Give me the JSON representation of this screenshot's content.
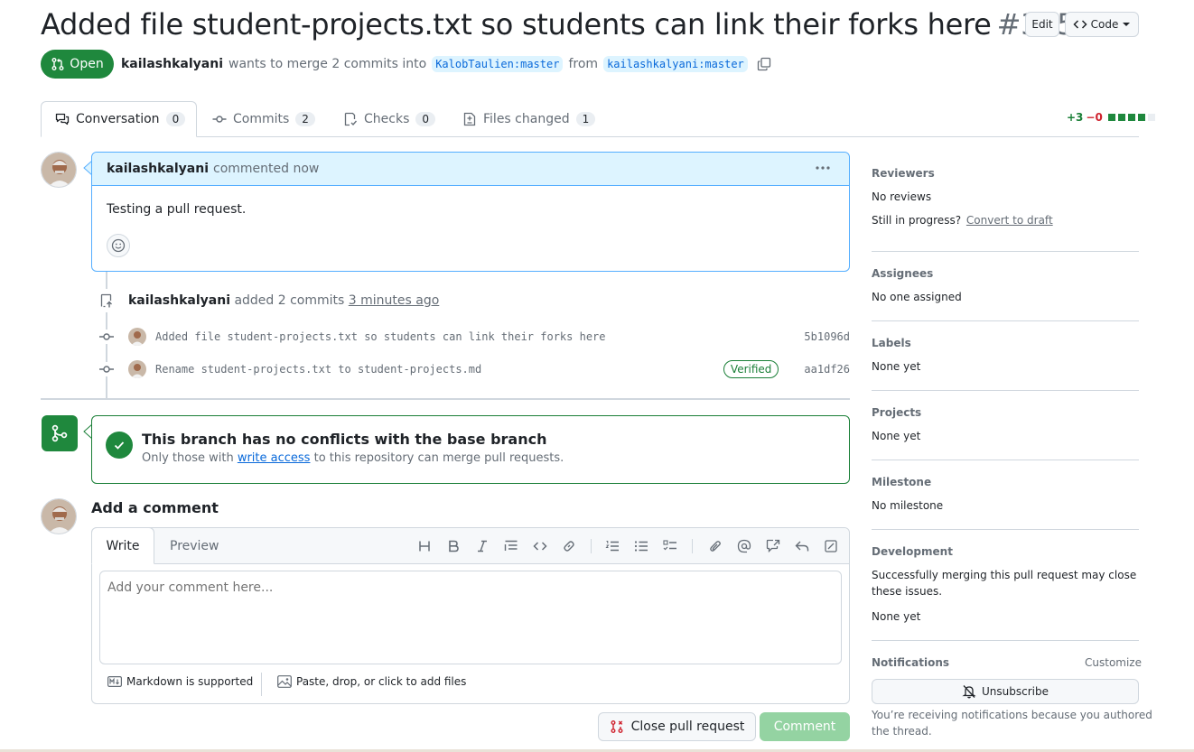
{
  "pr": {
    "title": "Added file student-projects.txt so students can link their forks here",
    "number": "#375",
    "edit_label": "Edit",
    "code_label": "Code",
    "state": "Open",
    "author": "kailashkalyani",
    "merge_text": "wants to merge 2 commits into",
    "base_branch": "KalobTaulien:master",
    "from_text": "from",
    "head_branch": "kailashkalyani:master"
  },
  "tabs": [
    {
      "label": "Conversation",
      "count": "0"
    },
    {
      "label": "Commits",
      "count": "2"
    },
    {
      "label": "Checks",
      "count": "0"
    },
    {
      "label": "Files changed",
      "count": "1"
    }
  ],
  "diffstat": {
    "additions": "+3",
    "deletions": "−0"
  },
  "comment": {
    "author": "kailashkalyani",
    "meta": "commented now",
    "body": "Testing a pull request."
  },
  "commits_event": {
    "author": "kailashkalyani",
    "text": "added 2 commits",
    "time": "3 minutes ago",
    "commits": [
      {
        "message": "Added file student-projects.txt so students can link their forks here",
        "sha": "5b1096d",
        "verified": ""
      },
      {
        "message": "Rename student-projects.txt to student-projects.md",
        "sha": "aa1df26",
        "verified": "Verified"
      }
    ]
  },
  "merge": {
    "title": "This branch has no conflicts with the base branch",
    "sub_prefix": "Only those with",
    "sub_link": "write access",
    "sub_suffix": "to this repository can merge pull requests."
  },
  "composer": {
    "heading": "Add a comment",
    "tab_write": "Write",
    "tab_preview": "Preview",
    "placeholder": "Add your comment here...",
    "markdown_note": "Markdown is supported",
    "attach_note": "Paste, drop, or click to add files",
    "close_label": "Close pull request",
    "comment_label": "Comment"
  },
  "sidebar": {
    "reviewers": {
      "heading": "Reviewers",
      "value": "No reviews",
      "progress_text": "Still in progress?",
      "progress_link": "Convert to draft"
    },
    "assignees": {
      "heading": "Assignees",
      "value": "No one assigned"
    },
    "labels": {
      "heading": "Labels",
      "value": "None yet"
    },
    "projects": {
      "heading": "Projects",
      "value": "None yet"
    },
    "milestone": {
      "heading": "Milestone",
      "value": "No milestone"
    },
    "development": {
      "heading": "Development",
      "line1": "Successfully merging this pull request may close",
      "line2": "these issues.",
      "value": "None yet"
    },
    "notifications": {
      "heading": "Notifications",
      "customize": "Customize",
      "unsubscribe": "Unsubscribe",
      "note1": "You’re receiving notifications because you authored",
      "note2": "the thread."
    }
  },
  "colors": {
    "accent": "#0969da",
    "success": "#1f883d",
    "comment_bg": "#ddf4ff"
  }
}
